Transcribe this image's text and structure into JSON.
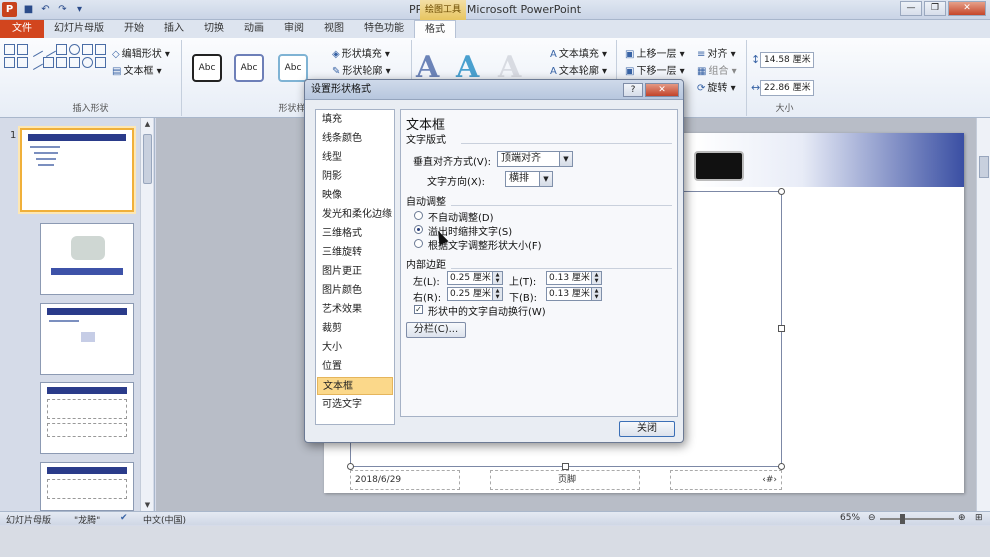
{
  "window": {
    "title": "PPT.pptx - Microsoft PowerPoint",
    "context_tab_header": "绘图工具",
    "minimize": "—",
    "restore": "❐",
    "close": "✕",
    "app_logo": "P"
  },
  "qat": {
    "save": "■",
    "undo": "↶",
    "redo": "↷",
    "customize": "▾"
  },
  "tabs": [
    "文件",
    "幻灯片母版",
    "开始",
    "插入",
    "切换",
    "动画",
    "审阅",
    "视图",
    "特色功能",
    "格式"
  ],
  "ribbon": {
    "insert_shapes": {
      "label": "插入形状",
      "edit_shape": "编辑形状 ▾",
      "text_box": "文本框 ▾"
    },
    "shape_styles": {
      "label": "形状样式",
      "abc1": "Abc",
      "abc2": "Abc",
      "abc3": "Abc",
      "fill": "形状填充 ▾",
      "outline": "形状轮廓 ▾"
    },
    "wordart": {
      "glyph": "A",
      "text_fill": "文本填充 ▾",
      "text_outline": "文本轮廓 ▾"
    },
    "arrange": {
      "bring_forward": "上移一层 ▾",
      "send_backward": "下移一层 ▾",
      "align": "对齐 ▾",
      "group": "组合 ▾",
      "rotate": "旋转 ▾"
    },
    "size": {
      "label": "大小",
      "height": "14.58 厘米",
      "width": "22.86 厘米"
    }
  },
  "slides": {
    "first_number": "1"
  },
  "slide": {
    "footer_date": "2018/6/29",
    "footer_center": "页脚",
    "footer_number": "‹#›"
  },
  "statusbar": {
    "view": "幻灯片母版",
    "theme": "\"龙腾\"",
    "language": "中文(中国)",
    "zoom": "65%"
  },
  "dialog": {
    "title": "设置形状格式",
    "help": "?",
    "close": "✕",
    "categories": [
      "填充",
      "线条颜色",
      "线型",
      "阴影",
      "映像",
      "发光和柔化边缘",
      "三维格式",
      "三维旋转",
      "图片更正",
      "图片颜色",
      "艺术效果",
      "裁剪",
      "大小",
      "位置",
      "文本框",
      "可选文字"
    ],
    "selected_category": "文本框",
    "panel_title": "文本框",
    "layout_section": "文字版式",
    "vertical_align_label": "垂直对齐方式(V):",
    "vertical_align_value": "顶端对齐",
    "text_direction_label": "文字方向(X):",
    "text_direction_value": "横排",
    "autofit_section": "自动调整",
    "autofit_options": [
      "不自动调整(D)",
      "溢出时缩排文字(S)",
      "根据文字调整形状大小(F)"
    ],
    "autofit_selected": 1,
    "margins_section": "内部边距",
    "left_label": "左(L):",
    "left_value": "0.25 厘米",
    "top_label": "上(T):",
    "top_value": "0.13 厘米",
    "right_label": "右(R):",
    "right_value": "0.25 厘米",
    "bottom_label": "下(B):",
    "bottom_value": "0.13 厘米",
    "wrap_label": "形状中的文字自动换行(W)",
    "wrap_checked": "✓",
    "columns_button": "分栏(C)...",
    "close_button": "关闭"
  }
}
